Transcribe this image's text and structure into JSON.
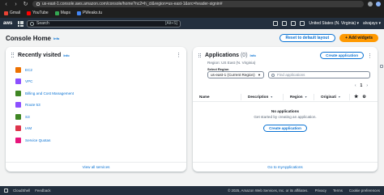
{
  "browser": {
    "url": "us-east-1.console.aws.amazon.com/console/home?nc2=h_ct&region=us-east-1&src=header-signin#",
    "bookmarks": [
      "Gmail",
      "YouTube",
      "Maps",
      "PWeaks.tu"
    ],
    "bookmark_colors": [
      "#ea4335",
      "#ff0000",
      "#34a853",
      "#4285f4"
    ]
  },
  "topbar": {
    "logo": "aws",
    "search_placeholder": "Search",
    "search_shortcut": "[Alt+S]",
    "region": "United States (N. Virginia) ▾",
    "account": "alvajays ▾"
  },
  "page": {
    "title": "Console Home",
    "info": "Info",
    "reset_button": "Reset to default layout",
    "add_widgets_button": "+ Add widgets"
  },
  "recently_visited": {
    "title": "Recently visited",
    "info": "Info",
    "items": [
      {
        "label": "EC2",
        "color": "#ed7100"
      },
      {
        "label": "VPC",
        "color": "#8c4fff"
      },
      {
        "label": "Billing and Cost Management",
        "color": "#3f8624"
      },
      {
        "label": "Route 53",
        "color": "#8c4fff"
      },
      {
        "label": "S3",
        "color": "#3f8624"
      },
      {
        "label": "IAM",
        "color": "#dd344c"
      },
      {
        "label": "Service Quotas",
        "color": "#e7157b"
      }
    ],
    "footer_link": "View all services"
  },
  "applications": {
    "title": "Applications",
    "count": "(0)",
    "info": "Info",
    "create_button": "Create application",
    "region_text": "Region: US East (N. Virginia)",
    "select_label": "Select Region",
    "select_value": "us-east-1 (Current Region)",
    "find_placeholder": "Find applications",
    "page_number": "1",
    "columns": [
      "Name",
      "Description",
      "Region",
      "Originati"
    ],
    "empty_title": "No applications",
    "empty_sub": "Get started by creating an application.",
    "empty_button": "Create application",
    "footer_link": "Go to myApplications"
  },
  "footer": {
    "cloudshell": "CloudShell",
    "feedback": "Feedback",
    "copyright": "© 2025, Amazon Web Services, Inc. or its affiliates.",
    "privacy": "Privacy",
    "terms": "Terms",
    "cookies": "Cookie preferences"
  }
}
